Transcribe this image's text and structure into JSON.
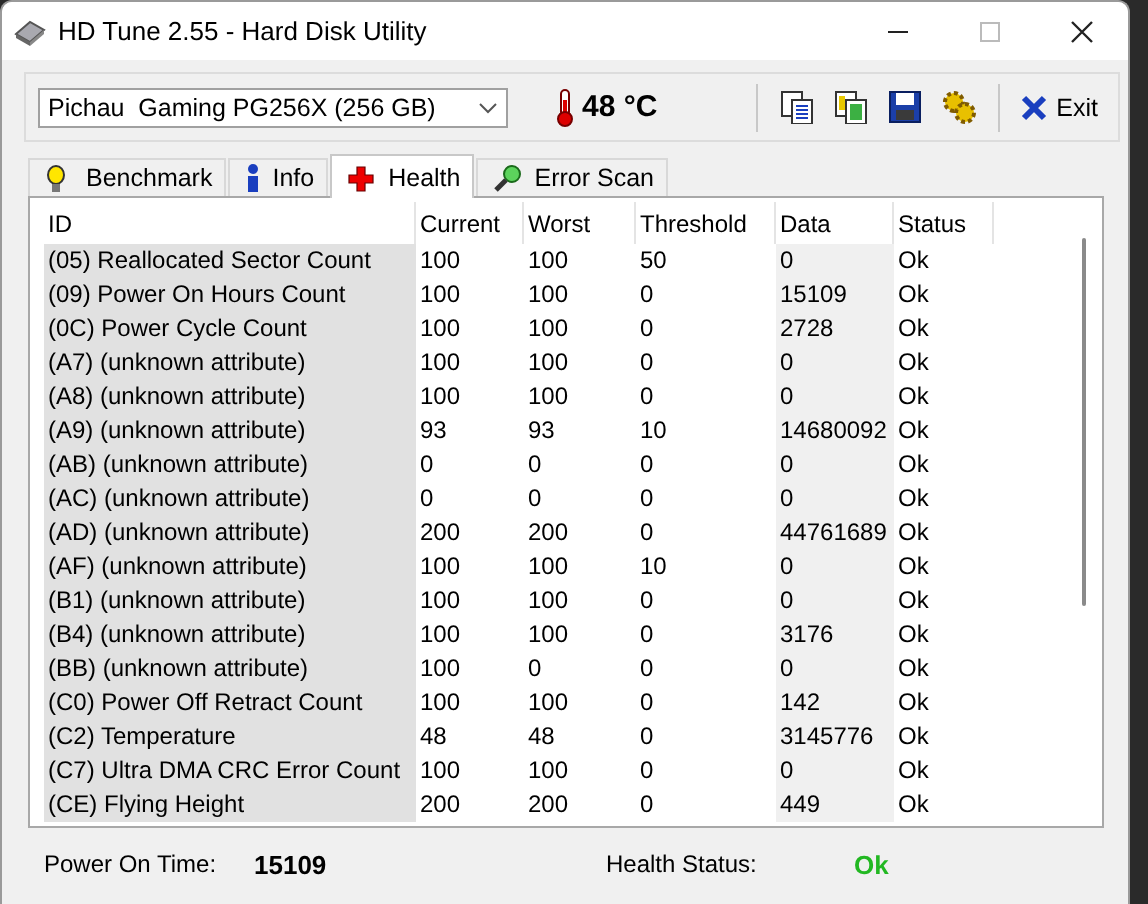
{
  "window": {
    "title": "HD Tune 2.55 - Hard Disk Utility"
  },
  "toolbar": {
    "drive": "Pichau  Gaming PG256X (256 GB)",
    "temperature": "48 °C",
    "exit": "Exit"
  },
  "tabs": [
    {
      "label": "Benchmark",
      "selected": false
    },
    {
      "label": "Info",
      "selected": false
    },
    {
      "label": "Health",
      "selected": true
    },
    {
      "label": "Error Scan",
      "selected": false
    }
  ],
  "table": {
    "columns": [
      "ID",
      "Current",
      "Worst",
      "Threshold",
      "Data",
      "Status"
    ],
    "rows": [
      [
        "(05) Reallocated Sector Count",
        "100",
        "100",
        "50",
        "0",
        "Ok"
      ],
      [
        "(09) Power On Hours Count",
        "100",
        "100",
        "0",
        "15109",
        "Ok"
      ],
      [
        "(0C) Power Cycle Count",
        "100",
        "100",
        "0",
        "2728",
        "Ok"
      ],
      [
        "(A7) (unknown attribute)",
        "100",
        "100",
        "0",
        "0",
        "Ok"
      ],
      [
        "(A8) (unknown attribute)",
        "100",
        "100",
        "0",
        "0",
        "Ok"
      ],
      [
        "(A9) (unknown attribute)",
        "93",
        "93",
        "10",
        "14680092",
        "Ok"
      ],
      [
        "(AB) (unknown attribute)",
        "0",
        "0",
        "0",
        "0",
        "Ok"
      ],
      [
        "(AC) (unknown attribute)",
        "0",
        "0",
        "0",
        "0",
        "Ok"
      ],
      [
        "(AD) (unknown attribute)",
        "200",
        "200",
        "0",
        "44761689",
        "Ok"
      ],
      [
        "(AF) (unknown attribute)",
        "100",
        "100",
        "10",
        "0",
        "Ok"
      ],
      [
        "(B1) (unknown attribute)",
        "100",
        "100",
        "0",
        "0",
        "Ok"
      ],
      [
        "(B4) (unknown attribute)",
        "100",
        "100",
        "0",
        "3176",
        "Ok"
      ],
      [
        "(BB) (unknown attribute)",
        "100",
        "0",
        "0",
        "0",
        "Ok"
      ],
      [
        "(C0) Power Off Retract Count",
        "100",
        "100",
        "0",
        "142",
        "Ok"
      ],
      [
        "(C2) Temperature",
        "48",
        "48",
        "0",
        "3145776",
        "Ok"
      ],
      [
        "(C7) Ultra DMA CRC Error Count",
        "100",
        "100",
        "0",
        "0",
        "Ok"
      ],
      [
        "(CE) Flying Height",
        "200",
        "200",
        "0",
        "449",
        "Ok"
      ]
    ]
  },
  "status_bar": {
    "power_on_label": "Power On Time:",
    "power_on_value": "15109",
    "health_label": "Health Status:",
    "health_value": "Ok"
  }
}
